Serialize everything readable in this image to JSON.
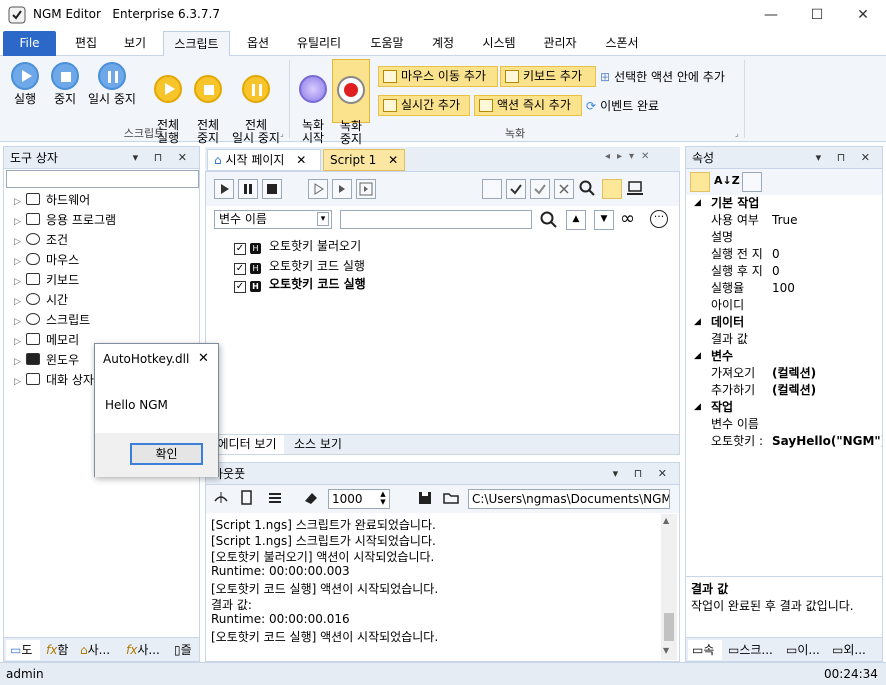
{
  "window": {
    "app_name": "NGM Editor",
    "edition": "Enterprise 6.3.7.7",
    "minimize": "—",
    "maximize": "☐",
    "close": "✕"
  },
  "menu": {
    "file": "File",
    "tabs": [
      "편집",
      "보기",
      "스크립트",
      "옵션",
      "유틸리티",
      "도움말",
      "계정",
      "시스템",
      "관리자",
      "스폰서"
    ]
  },
  "ribbon": {
    "script_group": {
      "label": "스크립트",
      "run": "실행",
      "stop": "중지",
      "pause": "일시 중지",
      "all_run": "전체\n실행",
      "all_stop": "전체\n중지",
      "all_pause": "전체\n일시 중지"
    },
    "record_group": {
      "label": "녹화",
      "rec_start": "녹화\n시작",
      "rec_stop": "녹화\n중지",
      "mouse_move": "마우스 이동 추가",
      "keyboard": "키보드 추가",
      "selected_action": "선택한 액션 안에 추가",
      "realtime": "실시간 추가",
      "action_now": "액션 즉시 추가",
      "event_done": "이벤트 완료"
    }
  },
  "toolbox": {
    "title": "도구 상자",
    "items": [
      "하드웨어",
      "응용 프로그램",
      "조건",
      "마우스",
      "키보드",
      "시간",
      "스크립트",
      "메모리",
      "윈도우",
      "대화 상자"
    ],
    "bottom_tabs": [
      "도",
      "함",
      "사...",
      "사...",
      "즐"
    ]
  },
  "documents": {
    "tabs": [
      "시작 페이지",
      "Script 1"
    ],
    "var_select": "변수 이름",
    "var_input": "",
    "actions": [
      {
        "label": "오토핫키 불러오기",
        "bold": false
      },
      {
        "label": "오토핫키 코드 실행",
        "bold": false
      },
      {
        "label": "오토핫키 코드 실행",
        "bold": true
      }
    ],
    "view_tabs": [
      "에디터 보기",
      "소스 보기"
    ]
  },
  "output": {
    "title": "아웃풋",
    "interval": "1000",
    "path": "C:\\Users\\ngmas\\Documents\\NGM6\\",
    "lines": [
      "[Script 1.ngs] 스크립트가 완료되었습니다.",
      "[Script 1.ngs] 스크립트가 시작되었습니다.",
      "[오토핫키 불러오기] 액션이 시작되었습니다.",
      "Runtime: 00:00:00.003",
      "[오토핫키 코드 실행] 액션이 시작되었습니다.",
      "결과 값:",
      "Runtime: 00:00:00.016",
      "[오토핫키 코드 실행] 액션이 시작되었습니다."
    ]
  },
  "properties": {
    "title": "속성",
    "sections": [
      {
        "name": "기본 작업",
        "rows": [
          [
            "사용 여부",
            "True"
          ],
          [
            "설명",
            ""
          ],
          [
            "실행 전 지",
            "0"
          ],
          [
            "실행 후 지",
            "0"
          ],
          [
            "실행율",
            "100"
          ],
          [
            "아이디",
            ""
          ]
        ]
      },
      {
        "name": "데이터",
        "rows": [
          [
            "결과 값",
            ""
          ]
        ]
      },
      {
        "name": "변수",
        "rows": [
          [
            "가져오기",
            "(컬렉션)"
          ],
          [
            "추가하기",
            "(컬렉션)"
          ]
        ]
      },
      {
        "name": "작업",
        "rows": [
          [
            "변수 이름",
            ""
          ],
          [
            "오토핫키 :",
            "SayHello(\"NGM\")"
          ]
        ]
      }
    ],
    "desc_title": "결과 값",
    "desc_text": "작업이 완료된 후 결과 값입니다.",
    "bottom_tabs": [
      "속",
      "스크...",
      "이...",
      "외..."
    ]
  },
  "status": {
    "user": "admin",
    "time": "00:24:34"
  },
  "dialog": {
    "title": "AutoHotkey.dll",
    "message": "Hello NGM",
    "ok": "확인",
    "close": "✕"
  },
  "colors": {
    "file_tab": "#2b68c7",
    "accent_gold": "#f7c52b",
    "accent_blue": "#6fa8e8"
  }
}
